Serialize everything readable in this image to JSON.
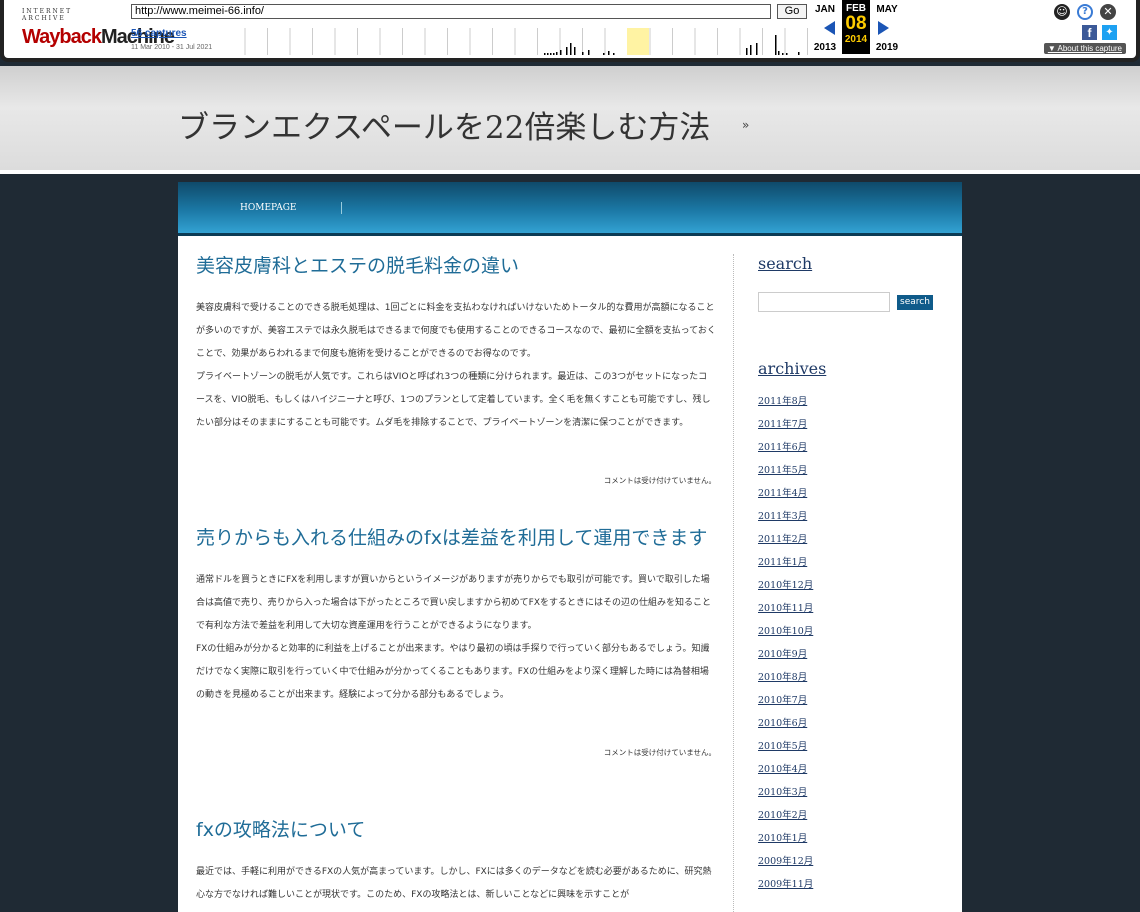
{
  "wayback": {
    "logo_top": "INTERNET ARCHIVE",
    "logo_main_1": "Wayback",
    "logo_main_2": "Machine",
    "url": "http://www.meimei-66.info/",
    "go_label": "Go",
    "captures": "56 captures",
    "date_range": "11 Mar 2010 - 31 Jul 2021",
    "prev_month": "JAN",
    "cur_month": "FEB",
    "next_month": "MAY",
    "cur_day": "08",
    "prev_year": "2013",
    "cur_year": "2014",
    "next_year": "2019",
    "about": "About this capture",
    "spark_bars": [
      0,
      0,
      0,
      0,
      0,
      0,
      0,
      0,
      0,
      0,
      0,
      0,
      0,
      0,
      0,
      0,
      0,
      0,
      0,
      0,
      0,
      0,
      0,
      0,
      0,
      0,
      0,
      0,
      0,
      0,
      0,
      0,
      0,
      0,
      0,
      0,
      0,
      0,
      0,
      0,
      0,
      0,
      0,
      0,
      0,
      0,
      0,
      0,
      0,
      0,
      0,
      0,
      0,
      0,
      0,
      0,
      0,
      0,
      0,
      0,
      0,
      0,
      0,
      0,
      0,
      0,
      0,
      0,
      0,
      0,
      0,
      0,
      0,
      0,
      0,
      0,
      0,
      0,
      0,
      0,
      0,
      0,
      0,
      0,
      0,
      0,
      0,
      0,
      0,
      0,
      0,
      0,
      0,
      0,
      0,
      0,
      0,
      0,
      0,
      0,
      0,
      0,
      0,
      0,
      0,
      0,
      0,
      0,
      0,
      0,
      0,
      0,
      0,
      0,
      0,
      0,
      0,
      0,
      0,
      0,
      0,
      0,
      0,
      0,
      0,
      0,
      0,
      0,
      0,
      0,
      0,
      0,
      0,
      0,
      0,
      0,
      0,
      0,
      0,
      0,
      0,
      0,
      0,
      0,
      0,
      0,
      0,
      0,
      0,
      0,
      0,
      0,
      0,
      0,
      0,
      0,
      0,
      0,
      0,
      0,
      0,
      0,
      0,
      0,
      0,
      0,
      0,
      0,
      0,
      0,
      0,
      0,
      0,
      0,
      0,
      0,
      0,
      0,
      0,
      0,
      0,
      0,
      0,
      0,
      0,
      0,
      0,
      0,
      0,
      0,
      0,
      0,
      0,
      0,
      0,
      0,
      0,
      0,
      0,
      0,
      0,
      0,
      0,
      0,
      0,
      0,
      0,
      0,
      0,
      0,
      0,
      0,
      0,
      0,
      0,
      0,
      0,
      0,
      0,
      0,
      0,
      0,
      0,
      0,
      0,
      0,
      0,
      0,
      0,
      0,
      0,
      0,
      0,
      0,
      0,
      0,
      0,
      0,
      0,
      0,
      0,
      0,
      0,
      0,
      0,
      0,
      0,
      0,
      0,
      0,
      0,
      0,
      0,
      0,
      0,
      0,
      0,
      0,
      0,
      0,
      0,
      0,
      0,
      0,
      0,
      0,
      0,
      0,
      0,
      0,
      0,
      0,
      0,
      0,
      0,
      0,
      0,
      0,
      0,
      0,
      0,
      0,
      0,
      0,
      0,
      0,
      0,
      0,
      0,
      0,
      0,
      0,
      0,
      0,
      0,
      0,
      0,
      0,
      0,
      0,
      0,
      0,
      0,
      0,
      0,
      0,
      0,
      0,
      0,
      0,
      0,
      0,
      0,
      0,
      0,
      0,
      0,
      0,
      0,
      0,
      0,
      0,
      0,
      0,
      0,
      0,
      0,
      0,
      0,
      0,
      0,
      0,
      0,
      0,
      0,
      0,
      0,
      0,
      0,
      0,
      0,
      0,
      0,
      0,
      0,
      0,
      0,
      0,
      0,
      0,
      0,
      0,
      0,
      0,
      0,
      0,
      0,
      0,
      0,
      0,
      0,
      0,
      0,
      0,
      0,
      0,
      0,
      0,
      0,
      0,
      0,
      0,
      0,
      0,
      0,
      0,
      0,
      0,
      0,
      0,
      0,
      0,
      0,
      0,
      0,
      0,
      0,
      0,
      0,
      0,
      0,
      0,
      0,
      0,
      0,
      0,
      0,
      0,
      0,
      0,
      0,
      0,
      0,
      0,
      0,
      0,
      0,
      0,
      0,
      0,
      0,
      0,
      0,
      0,
      0,
      0,
      0,
      0,
      0,
      0,
      0,
      0,
      0,
      0,
      0,
      0,
      0,
      0,
      0,
      0,
      0,
      0,
      0,
      0,
      0,
      0,
      0,
      0,
      0,
      0,
      0,
      0,
      0,
      0,
      0,
      0,
      0,
      0,
      0,
      0,
      0,
      0,
      0,
      0,
      0,
      0,
      0,
      0,
      0,
      0,
      0,
      0,
      0,
      0,
      0,
      0,
      0,
      0,
      0,
      0,
      0,
      0,
      0,
      0,
      0,
      0,
      0,
      0,
      0,
      0,
      0,
      0,
      0,
      0,
      0,
      0,
      0,
      0,
      0,
      0,
      0,
      0,
      0,
      0,
      0,
      0,
      0,
      0,
      0,
      0,
      0,
      0,
      0,
      0,
      0,
      0,
      0,
      0,
      0,
      0,
      0,
      0,
      0,
      0,
      0,
      0,
      0,
      0,
      0,
      0,
      0,
      0,
      0,
      0,
      0,
      0,
      0,
      0,
      0,
      0,
      0,
      0,
      0,
      0,
      0,
      0,
      0,
      0,
      0,
      0,
      0,
      0,
      0,
      0,
      0,
      0,
      0,
      0,
      0,
      0,
      0,
      0,
      0,
      0,
      0,
      0,
      0,
      0,
      0,
      0,
      0,
      0,
      0,
      0,
      0,
      0,
      0,
      0,
      0,
      0,
      0,
      0,
      0,
      0
    ]
  },
  "site": {
    "title": "ブランエクスペールを22倍楽しむ方法",
    "desc": "»"
  },
  "nav": {
    "home": "HOMEPAGE"
  },
  "posts": [
    {
      "title": "美容皮膚科とエステの脱毛料金の違い",
      "p1": "美容皮膚科で受けることのできる脱毛処理は、1回ごとに料金を支払わなければいけないためトータル的な費用が高額になることが多いのですが、美容エステでは永久脱毛はできるまで何度でも使用することのできるコースなので、最初に全額を支払っておくことで、効果があらわれるまで何度も施術を受けることができるのでお得なのです。",
      "p2": "プライベートゾーンの脱毛が人気です。これらはVIOと呼ばれ3つの種類に分けられます。最近は、この3つがセットになったコースを、VIO脱毛、もしくはハイジニーナと呼び、1つのプランとして定着しています。全く毛を無くすことも可能ですし、残したい部分はそのままにすることも可能です。ムダ毛を排除することで、プライベートゾーンを清潔に保つことができます。",
      "foot": "コメントは受け付けていません。"
    },
    {
      "title": "売りからも入れる仕組みのfxは差益を利用して運用できます",
      "p1": "通常ドルを買うときにFXを利用しますが買いからというイメージがありますが売りからでも取引が可能です。買いで取引した場合は高値で売り、売りから入った場合は下がったところで買い戻しますから初めてFXをするときにはその辺の仕組みを知ることで有利な方法で差益を利用して大切な資産運用を行うことができるようになります。",
      "p2": "FXの仕組みが分かると効率的に利益を上げることが出来ます。やはり最初の頃は手探りで行っていく部分もあるでしょう。知識だけでなく実際に取引を行っていく中で仕組みが分かってくることもあります。FXの仕組みをより深く理解した時には為替相場の動きを見極めることが出来ます。経験によって分かる部分もあるでしょう。",
      "foot": "コメントは受け付けていません。"
    },
    {
      "title": "fxの攻略法について",
      "p1": "最近では、手軽に利用ができるFXの人気が高まっています。しかし、FXには多くのデータなどを読む必要があるために、研究熱心な方でなければ難しいことが現状です。このため、FXの攻略法とは、新しいことなどに興味を示すことが",
      "p2": "",
      "foot": ""
    }
  ],
  "sidebar": {
    "search_heading": "search",
    "search_button": "search",
    "archives_heading": "archives",
    "archives": [
      "2011年8月",
      "2011年7月",
      "2011年6月",
      "2011年5月",
      "2011年4月",
      "2011年3月",
      "2011年2月",
      "2011年1月",
      "2010年12月",
      "2010年11月",
      "2010年10月",
      "2010年9月",
      "2010年8月",
      "2010年7月",
      "2010年6月",
      "2010年5月",
      "2010年4月",
      "2010年3月",
      "2010年2月",
      "2010年1月",
      "2009年12月",
      "2009年11月"
    ]
  }
}
